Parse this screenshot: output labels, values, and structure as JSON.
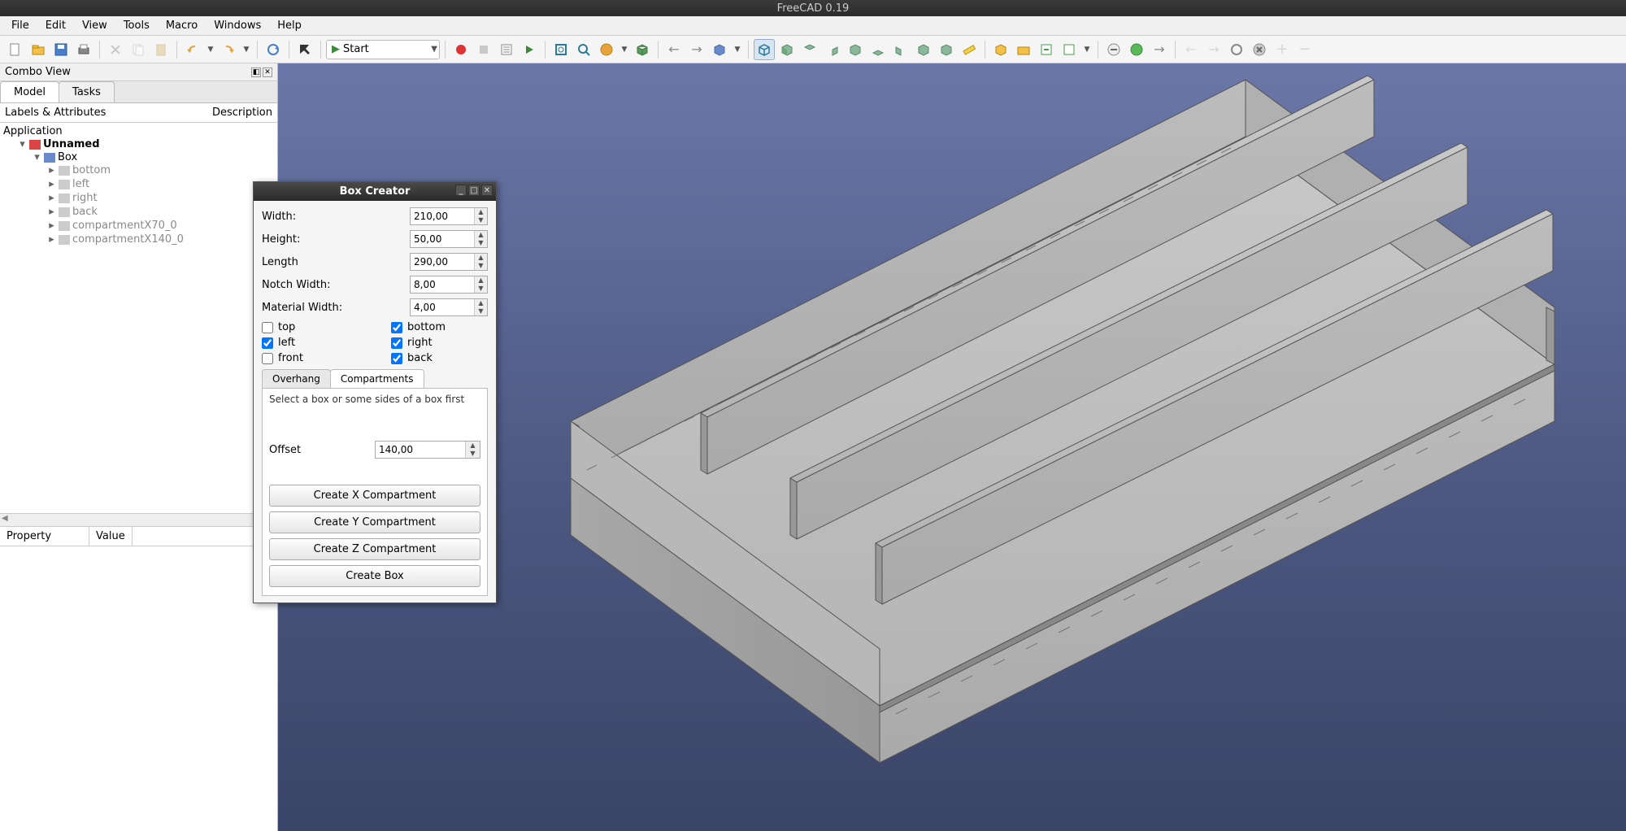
{
  "app": {
    "title": "FreeCAD 0.19"
  },
  "menu": {
    "items": [
      "File",
      "Edit",
      "View",
      "Tools",
      "Macro",
      "Windows",
      "Help"
    ]
  },
  "toolbar": {
    "workbench_label": "Start",
    "workbench_icon": "▶"
  },
  "combo_view": {
    "title": "Combo View",
    "tabs": {
      "model": "Model",
      "tasks": "Tasks"
    },
    "columns": {
      "labels": "Labels & Attributes",
      "desc": "Description"
    },
    "tree": {
      "root": "Application",
      "doc": "Unnamed",
      "group": "Box",
      "items": [
        "bottom",
        "left",
        "right",
        "back",
        "compartmentX70_0",
        "compartmentX140_0"
      ]
    },
    "props": {
      "property": "Property",
      "value": "Value"
    }
  },
  "dialog": {
    "title": "Box Creator",
    "fields": {
      "width_label": "Width:",
      "width_value": "210,00",
      "height_label": "Height:",
      "height_value": "50,00",
      "length_label": "Length",
      "length_value": "290,00",
      "notch_label": "Notch Width:",
      "notch_value": "8,00",
      "material_label": "Material Width:",
      "material_value": "4,00"
    },
    "checks": {
      "top": {
        "label": "top",
        "checked": false
      },
      "bottom": {
        "label": "bottom",
        "checked": true
      },
      "left": {
        "label": "left",
        "checked": true
      },
      "right": {
        "label": "right",
        "checked": true
      },
      "front": {
        "label": "front",
        "checked": false
      },
      "back": {
        "label": "back",
        "checked": true
      }
    },
    "tabs": {
      "overhang": "Overhang",
      "compartments": "Compartments"
    },
    "compartments": {
      "hint": "Select a box or some sides of a box first",
      "offset_label": "Offset",
      "offset_value": "140,00",
      "btn_x": "Create X Compartment",
      "btn_y": "Create Y Compartment",
      "btn_z": "Create Z Compartment",
      "btn_box": "Create Box"
    }
  }
}
